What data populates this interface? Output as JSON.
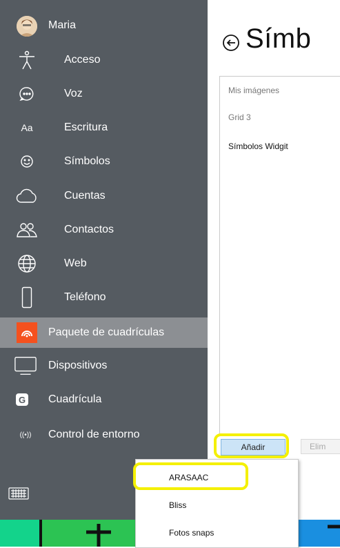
{
  "user": {
    "name": "Maria"
  },
  "sidebar": {
    "items": [
      {
        "label": "Acceso",
        "icon": "accessibility-icon"
      },
      {
        "label": "Voz",
        "icon": "speech-bubble-icon"
      },
      {
        "label": "Escritura",
        "icon": "text-aa-icon"
      },
      {
        "label": "Símbolos",
        "icon": "smiley-icon"
      },
      {
        "label": "Cuentas",
        "icon": "cloud-icon"
      },
      {
        "label": "Contactos",
        "icon": "people-icon"
      },
      {
        "label": "Web",
        "icon": "globe-icon"
      },
      {
        "label": "Teléfono",
        "icon": "phone-icon"
      },
      {
        "label": "Paquete de cuadrículas",
        "icon": "gridset-package-icon",
        "active": true
      },
      {
        "label": "Dispositivos",
        "icon": "monitor-icon"
      },
      {
        "label": "Cuadrícula",
        "icon": "grid-g-icon"
      },
      {
        "label": "Control de entorno",
        "icon": "wireless-signal-icon"
      }
    ]
  },
  "main": {
    "title": "Símb",
    "symbol_sets": [
      "Mis imágenes",
      "Grid 3",
      "Símbolos Widgit"
    ],
    "add_button": "Añadir",
    "delete_button": "Elim"
  },
  "dropdown": {
    "options": [
      "ARASAAC",
      "Bliss",
      "Fotos snaps"
    ]
  },
  "colors": {
    "sidebar": "#555b61",
    "active_item": "#8c8f93",
    "active_icon": "#f4511e",
    "highlight": "#f4f000",
    "bottom_green": "#2cc353",
    "bottom_teal": "#13d38b",
    "bottom_blue": "#1a8fe0"
  }
}
